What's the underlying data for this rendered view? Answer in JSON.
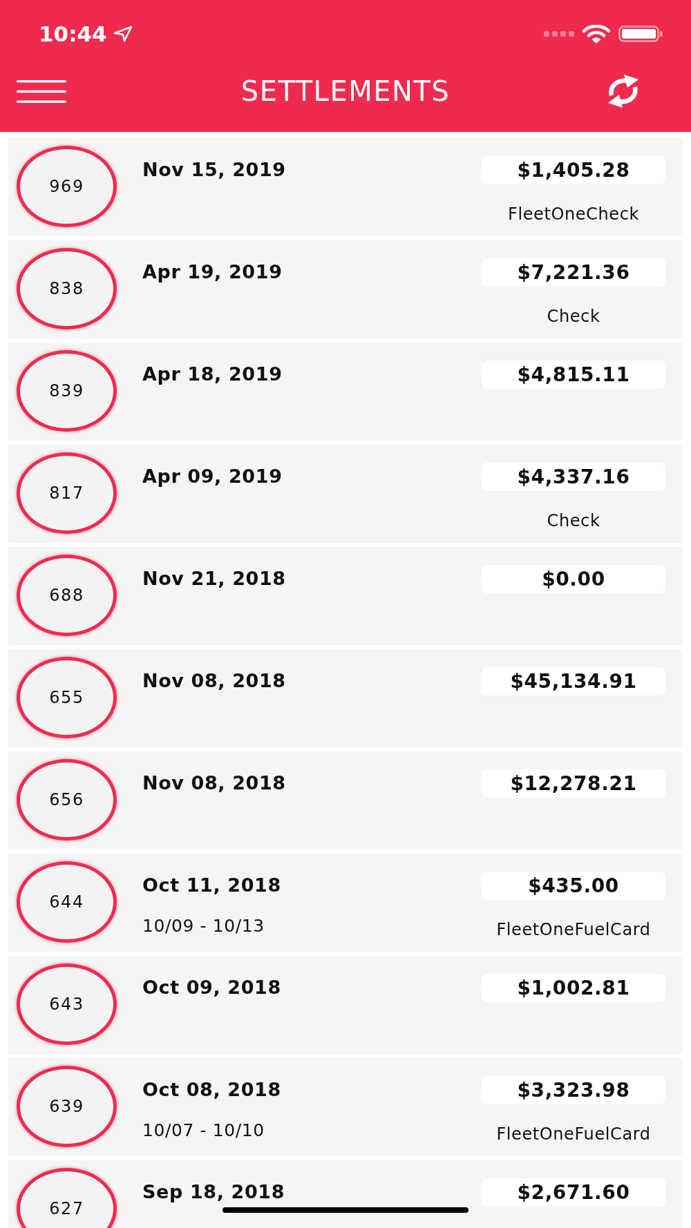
{
  "status_bar": {
    "time": "10:44"
  },
  "header": {
    "title": "SETTLEMENTS"
  },
  "settlements": [
    {
      "number": "969",
      "date": "Nov 15, 2019",
      "amount": "$1,405.28",
      "method": "FleetOneCheck"
    },
    {
      "number": "838",
      "date": "Apr 19, 2019",
      "amount": "$7,221.36",
      "method": "Check"
    },
    {
      "number": "839",
      "date": "Apr 18, 2019",
      "amount": "$4,815.11"
    },
    {
      "number": "817",
      "date": "Apr 09, 2019",
      "amount": "$4,337.16",
      "method": "Check"
    },
    {
      "number": "688",
      "date": "Nov 21, 2018",
      "amount": "$0.00"
    },
    {
      "number": "655",
      "date": "Nov 08, 2018",
      "amount": "$45,134.91"
    },
    {
      "number": "656",
      "date": "Nov 08, 2018",
      "amount": "$12,278.21"
    },
    {
      "number": "644",
      "date": "Oct 11, 2018",
      "amount": "$435.00",
      "period": "10/09 - 10/13",
      "method": "FleetOneFuelCard"
    },
    {
      "number": "643",
      "date": "Oct 09, 2018",
      "amount": "$1,002.81"
    },
    {
      "number": "639",
      "date": "Oct 08, 2018",
      "amount": "$3,323.98",
      "period": "10/07 - 10/10",
      "method": "FleetOneFuelCard"
    },
    {
      "number": "627",
      "date": "Sep 18, 2018",
      "amount": "$2,671.60"
    }
  ]
}
